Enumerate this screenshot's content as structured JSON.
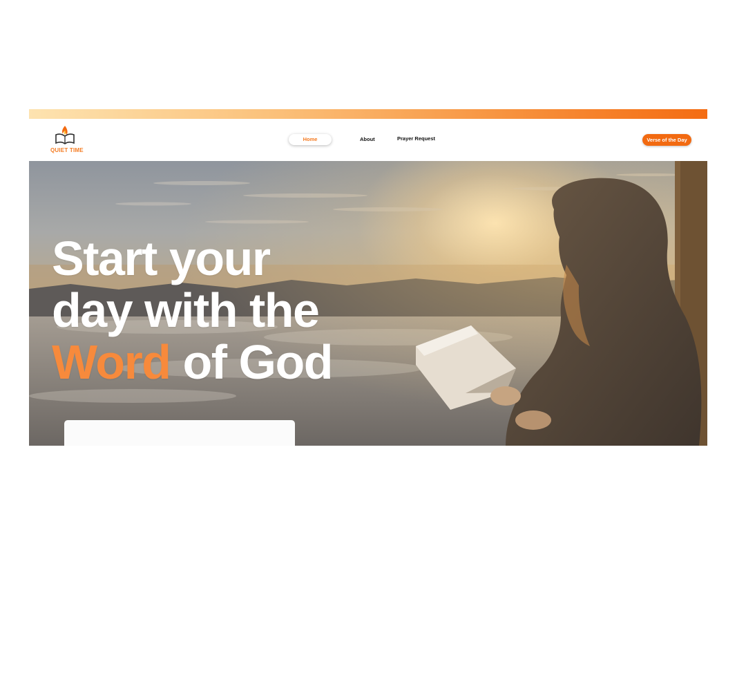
{
  "brand": {
    "name": "QUIET TIME",
    "color": "#f47a20",
    "icon": "flame-book-icon"
  },
  "nav": {
    "items": [
      {
        "label": "Home",
        "active": true
      },
      {
        "label": "About",
        "active": false
      },
      {
        "label": "Prayer Request",
        "active": false
      }
    ],
    "cta_label": "Verse of the Day"
  },
  "hero": {
    "line1": "Start your",
    "line2": "day with the",
    "line3_accent": "Word",
    "line3_rest": "of God"
  },
  "colors": {
    "accent": "#f26a11",
    "headline_accent": "#f78a3c",
    "top_strip_start": "#fde3b0",
    "top_strip_end": "#f46c12"
  }
}
